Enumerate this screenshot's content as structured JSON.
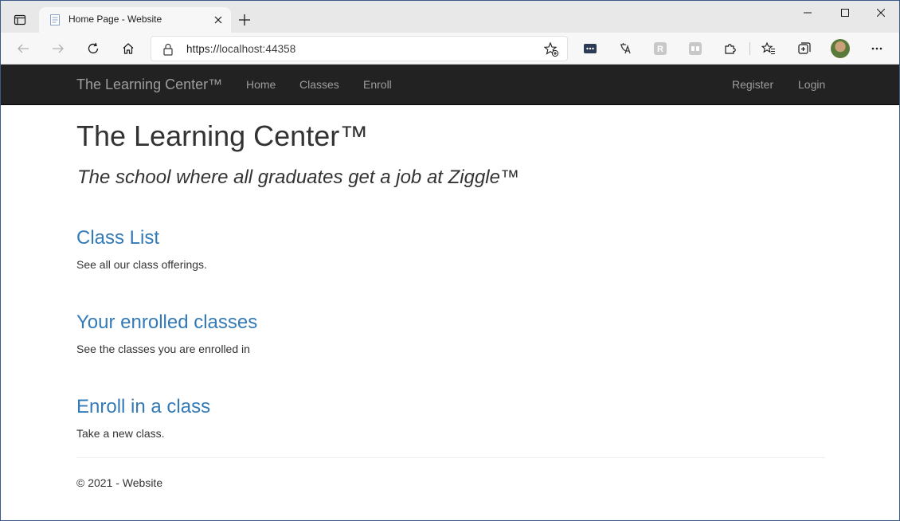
{
  "browser": {
    "tab_title": "Home Page - Website",
    "url_scheme": "https://",
    "url_host": "localhost:44358"
  },
  "navbar": {
    "brand": "The Learning Center™",
    "links": [
      "Home",
      "Classes",
      "Enroll"
    ],
    "right_links": [
      "Register",
      "Login"
    ]
  },
  "page": {
    "title": "The Learning Center™",
    "lead": "The school where all graduates get a job at Ziggle™",
    "sections": [
      {
        "heading": "Class List",
        "text": "See all our class offerings."
      },
      {
        "heading": "Your enrolled classes",
        "text": "See the classes you are enrolled in"
      },
      {
        "heading": "Enroll in a class",
        "text": "Take a new class."
      }
    ],
    "footer": "© 2021 - Website"
  },
  "colors": {
    "navbar_bg": "#222222",
    "nav_text": "#9d9d9d",
    "link": "#337ab7",
    "text": "#333333"
  },
  "icons": {
    "tab_actions": "tab-actions-icon",
    "favicon": "page-favicon-icon",
    "close": "close-icon",
    "new_tab": "plus-icon",
    "back": "back-arrow-icon",
    "forward": "forward-arrow-icon",
    "refresh": "refresh-icon",
    "home": "home-icon",
    "lock": "lock-icon",
    "favorite": "add-favorite-icon"
  }
}
